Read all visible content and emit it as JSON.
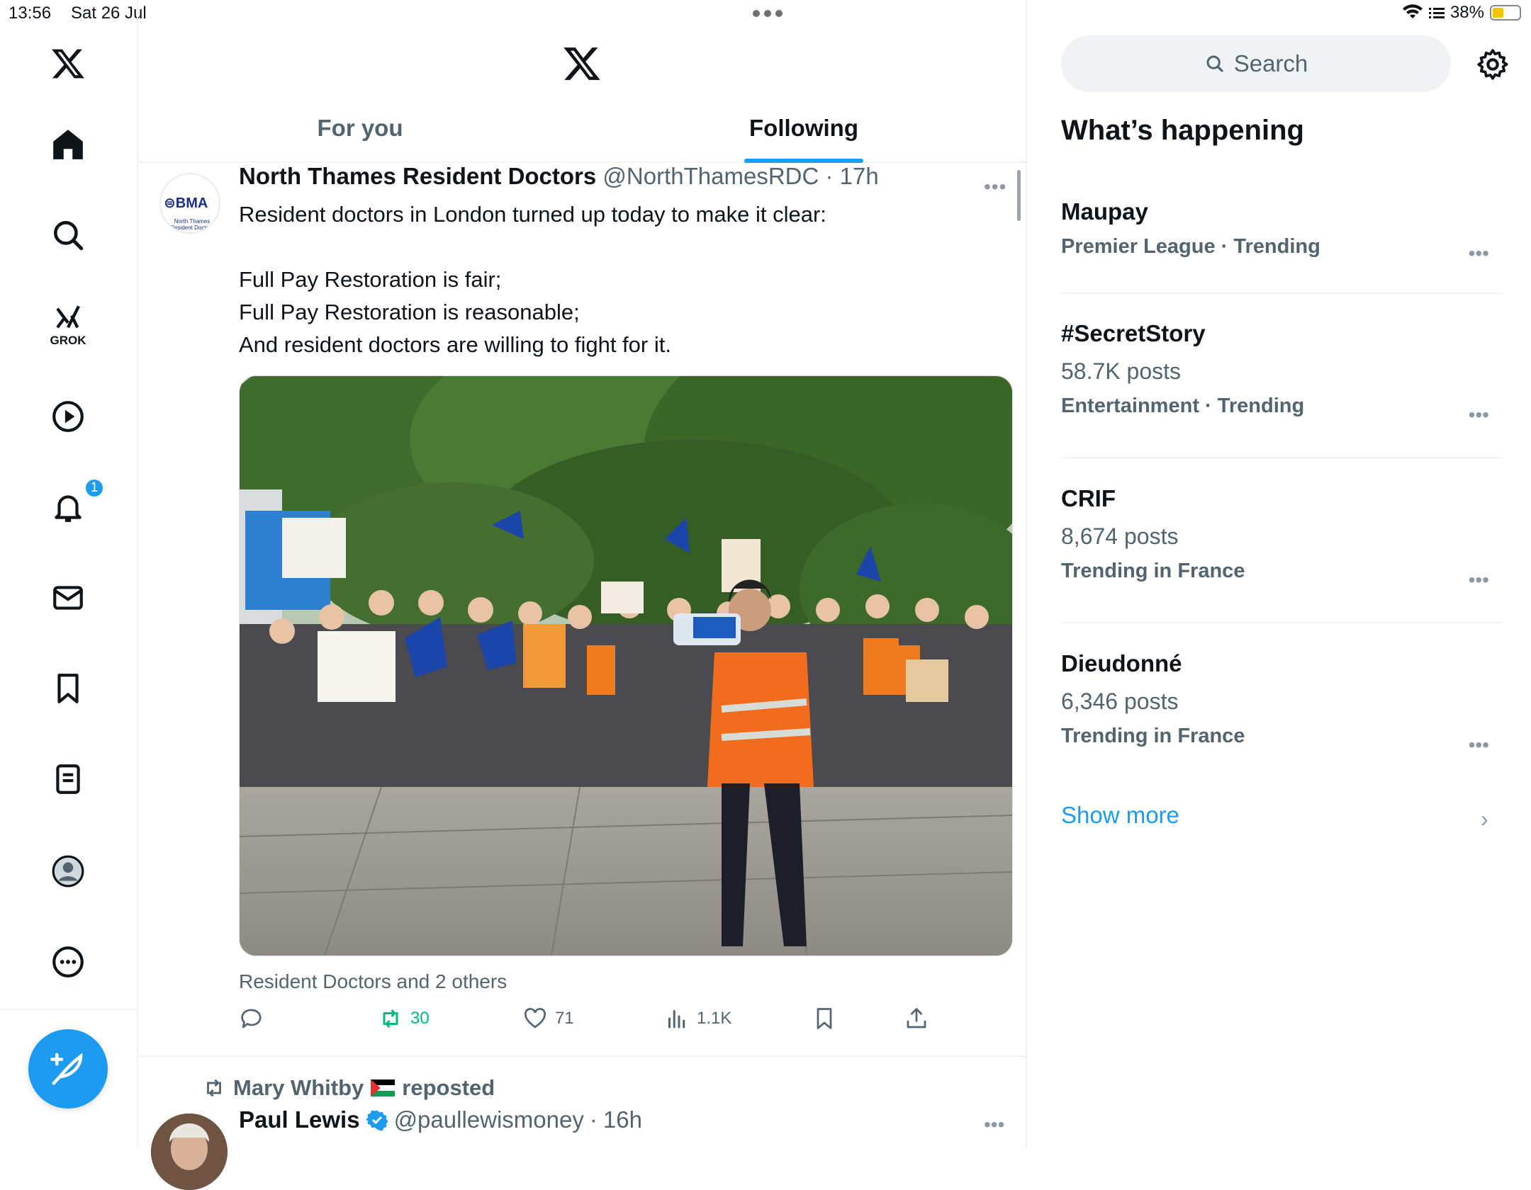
{
  "status": {
    "time": "13:56",
    "date": "Sat 26 Jul",
    "battery": "38%"
  },
  "nav": {
    "notification_count": "1",
    "grok_label": "GROK"
  },
  "tabs": [
    {
      "label": "For you",
      "active": false
    },
    {
      "label": "Following",
      "active": true
    }
  ],
  "post": {
    "avatar_text": "BMA",
    "avatar_subtext": "North Thames Resident Doctors",
    "author_name": "North Thames Resident Doctors",
    "handle": "@NorthThamesRDC",
    "time": "17h",
    "text": "Resident doctors in London turned up today to make it clear:\n\nFull Pay Restoration is fair;\nFull Pay Restoration is reasonable;\nAnd resident doctors are willing to fight for it.",
    "media_caption": "Resident Doctors and 2 others",
    "stats": {
      "reposts": "30",
      "likes": "71",
      "views": "1.1K"
    }
  },
  "next_post": {
    "reposter": "Mary Whitby",
    "reposted_label": "reposted",
    "author_name": "Paul Lewis",
    "handle": "@paullewismoney",
    "time": "16h"
  },
  "sidebar": {
    "search_placeholder": "Search",
    "section_title": "What’s happening",
    "trends": [
      {
        "name": "Maupay",
        "posts": "",
        "meta": "Premier League · Trending"
      },
      {
        "name": "#SecretStory",
        "posts": "58.7K posts",
        "meta": "Entertainment · Trending"
      },
      {
        "name": "CRIF",
        "posts": "8,674 posts",
        "meta": "Trending in France"
      },
      {
        "name": "Dieudonné",
        "posts": "6,346 posts",
        "meta": "Trending in France"
      }
    ],
    "show_more": "Show more"
  },
  "colors": {
    "accent": "#1d9bf0",
    "repost_green": "#00ba7c",
    "secondary_text": "#536471"
  }
}
